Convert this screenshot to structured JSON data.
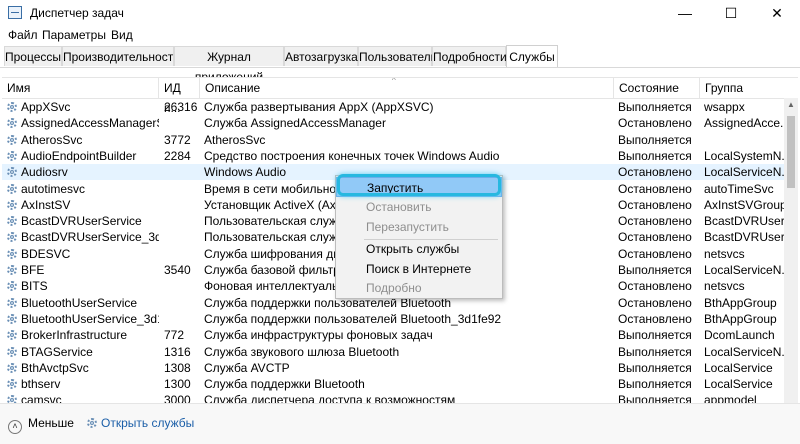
{
  "window": {
    "title": "Диспетчер задач",
    "controls": {
      "minimize": "—",
      "maximize": "☐",
      "close": "✕"
    }
  },
  "menu": [
    "Файл",
    "Параметры",
    "Вид"
  ],
  "tabs": [
    "Процессы",
    "Производительность",
    "Журнал приложений",
    "Автозагрузка",
    "Пользователи",
    "Подробности",
    "Службы"
  ],
  "active_tab": "Службы",
  "table": {
    "headers": [
      "Имя",
      "ИД п...",
      "Описание",
      "Состояние",
      "Группа"
    ],
    "rows": [
      [
        "AppXSvc",
        "26316",
        "Служба развертывания AppX (AppXSVC)",
        "Выполняется",
        "wsappx"
      ],
      [
        "AssignedAccessManagerSvc",
        "",
        "Служба AssignedAccessManager",
        "Остановлено",
        "AssignedAcce..."
      ],
      [
        "AtherosSvc",
        "3772",
        "AtherosSvc",
        "Выполняется",
        ""
      ],
      [
        "AudioEndpointBuilder",
        "2284",
        "Средство построения конечных точек Windows Audio",
        "Выполняется",
        "LocalSystemN..."
      ],
      [
        "Audiosrv",
        "",
        "Windows Audio",
        "Остановлено",
        "LocalServiceN..."
      ],
      [
        "autotimesvc",
        "",
        "Время в сети мобильной св",
        "Остановлено",
        "autoTimeSvc"
      ],
      [
        "AxInstSV",
        "",
        "Установщик ActiveX (AxInst",
        "Остановлено",
        "AxInstSVGroup"
      ],
      [
        "BcastDVRUserService",
        "",
        "Пользовательская служба D",
        "Остановлено",
        "BcastDVRUser..."
      ],
      [
        "BcastDVRUserService_3d1fe...",
        "",
        "Пользовательская служба D",
        "Остановлено",
        "BcastDVRUser..."
      ],
      [
        "BDESVC",
        "",
        "Служба шифрования диско",
        "Остановлено",
        "netsvcs"
      ],
      [
        "BFE",
        "3540",
        "Служба базовой фильтраци",
        "Выполняется",
        "LocalServiceN..."
      ],
      [
        "BITS",
        "",
        "Фоновая интеллектуальная",
        "Остановлено",
        "netsvcs"
      ],
      [
        "BluetoothUserService",
        "",
        "Служба поддержки пользователей Bluetooth",
        "Остановлено",
        "BthAppGroup"
      ],
      [
        "BluetoothUserService_3d1fe...",
        "",
        "Служба поддержки пользователей Bluetooth_3d1fe92",
        "Остановлено",
        "BthAppGroup"
      ],
      [
        "BrokerInfrastructure",
        "772",
        "Служба инфраструктуры фоновых задач",
        "Выполняется",
        "DcomLaunch"
      ],
      [
        "BTAGService",
        "1316",
        "Служба звукового шлюза Bluetooth",
        "Выполняется",
        "LocalServiceN..."
      ],
      [
        "BthAvctpSvc",
        "1308",
        "Служба AVCTP",
        "Выполняется",
        "LocalService"
      ],
      [
        "bthserv",
        "1300",
        "Служба поддержки Bluetooth",
        "Выполняется",
        "LocalService"
      ],
      [
        "camsvc",
        "3000",
        "Служба диспетчера доступа к возможностям",
        "Выполняется",
        "appmodel"
      ]
    ],
    "selected_row": "Audiosrv"
  },
  "context_menu": {
    "items": [
      {
        "label": "Запустить",
        "enabled": true
      },
      {
        "label": "Остановить",
        "enabled": false
      },
      {
        "label": "Перезапустить",
        "enabled": false
      },
      {
        "label": "Открыть службы",
        "enabled": true
      },
      {
        "label": "Поиск в Интернете",
        "enabled": true
      },
      {
        "label": "Подробно",
        "enabled": false
      }
    ],
    "highlighted": "Запустить"
  },
  "footer": {
    "less_label": "Меньше",
    "open_services_label": "Открыть службы"
  },
  "colors": {
    "selection": "#e5f3ff",
    "menu_highlight": "#91c9f7",
    "glow": "#27b8e0",
    "link": "#1c5fa8"
  },
  "icons": {
    "service": "gear-icon",
    "footer_less": "chevron-up-icon",
    "footer_open": "gear-icon"
  }
}
